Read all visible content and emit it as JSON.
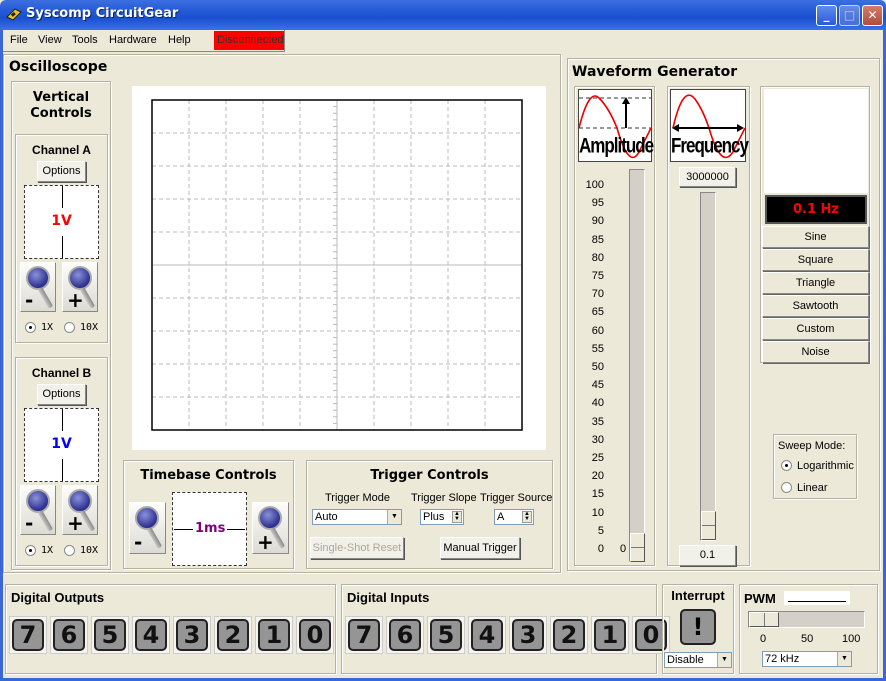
{
  "window": {
    "title": "Syscomp CircuitGear",
    "controls": {
      "minimize": "_",
      "maximize": "□",
      "close": "✕"
    }
  },
  "menu": {
    "items": [
      "File",
      "View",
      "Tools",
      "Hardware",
      "Help"
    ],
    "status": "Disconnected",
    "status_color": "#ff0000"
  },
  "oscilloscope": {
    "title": "Oscilloscope",
    "vertical_controls": {
      "title_line1": "Vertical",
      "title_line2": "Controls",
      "channels": [
        {
          "name": "Channel A",
          "options_label": "Options",
          "scale": "1V",
          "scale_color": "#ff0000",
          "probe_options": [
            "1X",
            "10X"
          ],
          "probe_selected": "1X"
        },
        {
          "name": "Channel B",
          "options_label": "Options",
          "scale": "1V",
          "scale_color": "#0000ff",
          "probe_options": [
            "1X",
            "10X"
          ],
          "probe_selected": "1X"
        }
      ]
    },
    "screen": {
      "h_divisions": 10,
      "v_divisions": 10
    },
    "timebase": {
      "title": "Timebase Controls",
      "value": "1ms",
      "value_color": "#800080"
    },
    "trigger": {
      "title": "Trigger Controls",
      "mode_label": "Trigger Mode",
      "mode_value": "Auto",
      "slope_label": "Trigger Slope",
      "slope_value": "Plus",
      "source_label": "Trigger Source",
      "source_value": "A",
      "single_shot_label": "Single-Shot Reset",
      "manual_trigger_label": "Manual Trigger"
    }
  },
  "waveform_generator": {
    "title": "Waveform Generator",
    "amplitude": {
      "icon_label": "Amplitude",
      "scale": [
        "100",
        "95",
        "90",
        "85",
        "80",
        "75",
        "70",
        "65",
        "60",
        "55",
        "50",
        "45",
        "40",
        "35",
        "30",
        "25",
        "20",
        "15",
        "10",
        "5",
        "0"
      ],
      "value": "0",
      "slider_percent": 0
    },
    "frequency": {
      "icon_label": "Frequency",
      "max_button": "3000000",
      "min_button": "0.1",
      "slider_fraction": 0.0
    },
    "display": "0.1 Hz",
    "display_color": "#ff0000",
    "waveforms": [
      "Sine",
      "Square",
      "Triangle",
      "Sawtooth",
      "Custom",
      "Noise"
    ],
    "sweep": {
      "label": "Sweep Mode:",
      "options": [
        "Logarithmic",
        "Linear"
      ],
      "selected": "Logarithmic"
    }
  },
  "digital_outputs": {
    "title": "Digital Outputs",
    "bits": [
      "7",
      "6",
      "5",
      "4",
      "3",
      "2",
      "1",
      "0"
    ]
  },
  "digital_inputs": {
    "title": "Digital Inputs",
    "bits": [
      "7",
      "6",
      "5",
      "4",
      "3",
      "2",
      "1",
      "0"
    ]
  },
  "interrupt": {
    "title": "Interrupt",
    "icon": "!",
    "mode": "Disable"
  },
  "pwm": {
    "title": "PWM",
    "scale": [
      "0",
      "50",
      "100"
    ],
    "slider_percent": 0,
    "frequency": "72 kHz"
  }
}
